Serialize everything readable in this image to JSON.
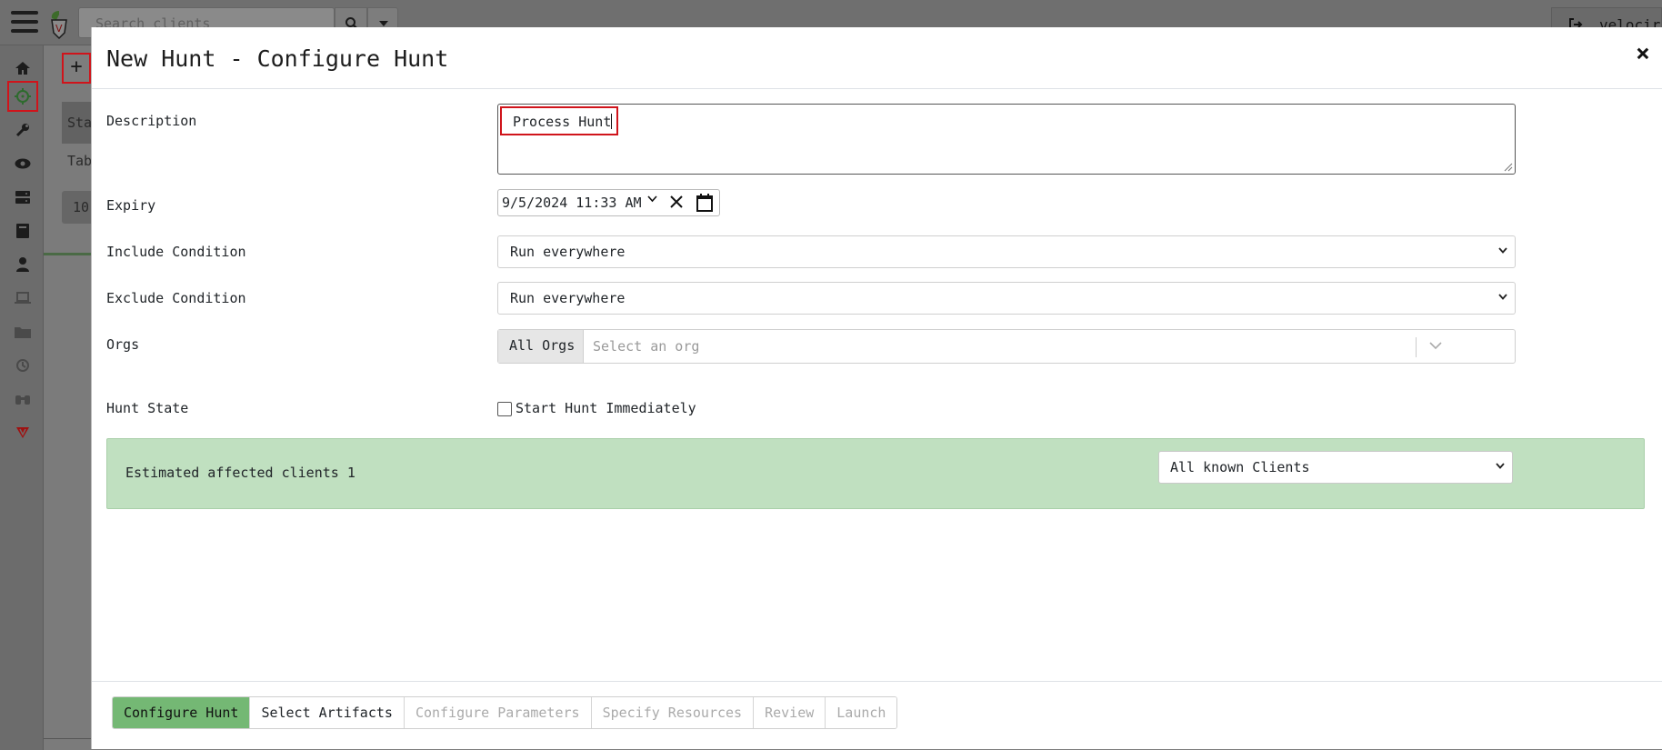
{
  "topbar": {
    "search_placeholder": "Search clients",
    "username": "velocira"
  },
  "sidebar": {
    "items": [
      {
        "icon": "home-icon"
      },
      {
        "icon": "crosshair-icon",
        "active": true
      },
      {
        "icon": "wrench-icon"
      },
      {
        "icon": "eye-icon"
      },
      {
        "icon": "server-icon"
      },
      {
        "icon": "book-icon"
      },
      {
        "icon": "user-icon"
      },
      {
        "icon": "laptop-icon"
      },
      {
        "icon": "folder-icon"
      },
      {
        "icon": "history-icon"
      },
      {
        "icon": "binoculars-icon"
      },
      {
        "icon": "velociraptor-logo-icon"
      }
    ]
  },
  "background": {
    "add_button": "+",
    "table_header": "Sta",
    "tab_label": "Tab",
    "page_size": "10"
  },
  "modal": {
    "title": "New Hunt - Configure Hunt",
    "close": "×",
    "labels": {
      "description": "Description",
      "expiry": "Expiry",
      "include_condition": "Include Condition",
      "exclude_condition": "Exclude Condition",
      "orgs": "Orgs",
      "hunt_state": "Hunt State"
    },
    "description_value": "Process Hunt",
    "expiry_value": "9/5/2024  11:33  AM",
    "include_condition_value": "Run everywhere",
    "exclude_condition_value": "Run everywhere",
    "orgs_prefix": "All Orgs",
    "orgs_placeholder": "Select an org",
    "start_immediately_label": "Start Hunt Immediately",
    "start_immediately_checked": false,
    "estimate_text": "Estimated affected clients 1",
    "estimate_scope": "All known Clients",
    "steps": [
      {
        "label": "Configure Hunt",
        "state": "active"
      },
      {
        "label": "Select Artifacts",
        "state": "enabled"
      },
      {
        "label": "Configure Parameters",
        "state": "disabled"
      },
      {
        "label": "Specify Resources",
        "state": "disabled"
      },
      {
        "label": "Review",
        "state": "disabled"
      },
      {
        "label": "Launch",
        "state": "disabled"
      }
    ]
  },
  "colors": {
    "active_step": "#74b874",
    "estimate_panel": "#c0e0c0",
    "highlight": "#d0141b",
    "overlay": "#7a7a7a"
  }
}
